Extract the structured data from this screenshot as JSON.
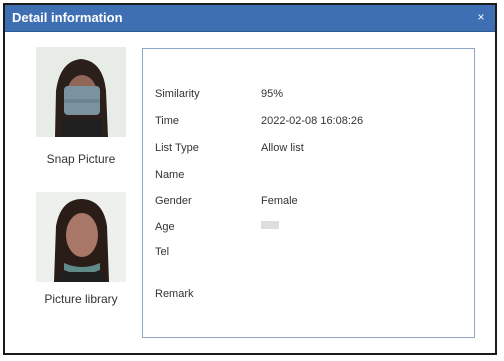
{
  "dialog": {
    "title": "Detail information",
    "close_symbol": "×"
  },
  "snap": {
    "caption": "Snap Picture",
    "icon": "person-photo-masked"
  },
  "library": {
    "caption": "Picture library",
    "icon": "person-photo"
  },
  "details": {
    "similarity_label": "Similarity",
    "similarity_value": "95%",
    "time_label": "Time",
    "time_value": "2022-02-08 16:08:26",
    "list_type_label": "List Type",
    "list_type_value": "Allow list",
    "name_label": "Name",
    "name_value": "",
    "gender_label": "Gender",
    "gender_value": "Female",
    "age_label": "Age",
    "age_value": "",
    "tel_label": "Tel",
    "tel_value": "",
    "remark_label": "Remark",
    "remark_value": ""
  },
  "colors": {
    "titlebar": "#3f6fb3",
    "panel_border": "#8ea7c9"
  }
}
